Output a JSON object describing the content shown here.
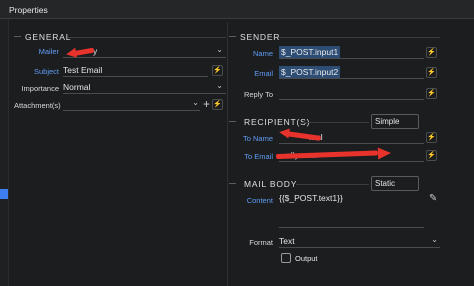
{
  "window": {
    "title": "Properties"
  },
  "general": {
    "header": "GENERAL",
    "mailer": {
      "label": "Mailer",
      "value": "y"
    },
    "subject": {
      "label": "Subject",
      "value": "Test Email"
    },
    "importance": {
      "label": "Importance",
      "value": "Normal"
    },
    "attachments": {
      "label": "Attachment(s)",
      "add": "+"
    }
  },
  "sender": {
    "header": "SENDER",
    "name": {
      "label": "Name",
      "value": "$_POST.input1"
    },
    "email": {
      "label": "Email",
      "value": "$_POST.input2"
    },
    "reply_to": {
      "label": "Reply To",
      "value": ""
    }
  },
  "recipients": {
    "header": "RECIPIENT(S)",
    "mode": "Simple",
    "to_name": {
      "label": "To Name",
      "value": "...al"
    },
    "to_email": {
      "label": "To Email",
      "value": "...ally.co..."
    }
  },
  "mail_body": {
    "header": "MAIL BODY",
    "mode": "Static",
    "content": {
      "label": "Content",
      "value": "{{$_POST.text1}}"
    },
    "format": {
      "label": "Format",
      "value": "Text"
    },
    "output": {
      "label": "Output"
    }
  },
  "icons": {
    "bolt": "⚡",
    "chevron": "⌄",
    "caret": "─",
    "pencil": "✎",
    "check": "✓"
  },
  "colors": {
    "accent": "#5f9cf4",
    "highlight": "#2d4d74",
    "bolt": "#e3c84a",
    "arrow": "#e8322c"
  }
}
